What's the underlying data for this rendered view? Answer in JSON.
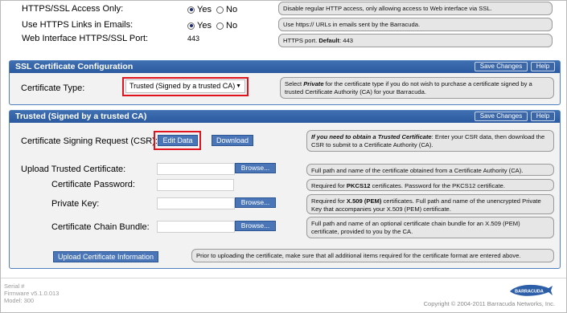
{
  "top": {
    "https_only": {
      "label": "HTTPS/SSL Access Only:",
      "opt_yes": "Yes",
      "opt_no": "No",
      "selected": "Yes",
      "help": "Disable regular HTTP access, only allowing access to Web interface via SSL."
    },
    "https_links": {
      "label": "Use HTTPS Links in Emails:",
      "opt_yes": "Yes",
      "opt_no": "No",
      "selected": "Yes",
      "help": "Use https:// URLs in emails sent by the Barracuda."
    },
    "ssl_port": {
      "label": "Web Interface HTTPS/SSL Port:",
      "value": "443",
      "help_prefix": "HTTPS port. ",
      "help_bold": "Default",
      "help_suffix": ": 443"
    }
  },
  "ssl_panel": {
    "title": "SSL Certificate Configuration",
    "save_label": "Save Changes",
    "help_label": "Help",
    "cert_type_label": "Certificate Type:",
    "cert_type_value": "Trusted (Signed by a trusted CA)",
    "help_pre": "Select ",
    "help_bold": "Private",
    "help_post": " for the certificate type if you do not wish to purchase a certificate signed by a trusted Certificate Authority (CA) for your Barracuda."
  },
  "trusted_panel": {
    "title": "Trusted (Signed by a trusted CA)",
    "save_label": "Save Changes",
    "help_label": "Help",
    "csr_label": "Certificate Signing Request (CSR):",
    "edit_label": "Edit Data",
    "download_label": "Download",
    "csr_help_bold": "If you need to obtain a Trusted Certificate",
    "csr_help_rest": ": Enter your CSR data, then download the CSR to submit to a Certificate Authority (CA).",
    "upload_label": "Upload Trusted Certificate:",
    "upload_help": "Full path and name of the certificate obtained from a Certificate Authority (CA).",
    "password_label": "Certificate Password:",
    "password_help_pre": "Required for ",
    "password_help_bold": "PKCS12",
    "password_help_post": " certificates. Password for the PKCS12 certificate.",
    "key_label": "Private Key:",
    "key_help_pre": "Required for ",
    "key_help_bold": "X.509 (PEM)",
    "key_help_post": " certificates. Full path and name of the unencrypted Private Key that accompanies your X.509 (PEM) certificate.",
    "chain_label": "Certificate Chain Bundle:",
    "chain_help": "Full path and name of an optional certificate chain bundle for an X.509 (PEM) certificate, provided to you by the CA.",
    "browse_label": "Browse...",
    "upload_btn_label": "Upload Certificate Information",
    "upload_btn_help": "Prior to uploading the certificate, make sure that all additional items required for the certificate format are entered above."
  },
  "footer": {
    "serial": "Serial #",
    "firmware": "Firmware v5.1.0.013",
    "model": "Model: 300",
    "copyright": "Copyright © 2004-2011 Barracuda Networks, Inc.",
    "logo_text": "BARRACUDA"
  },
  "colors": {
    "panel_header": "#2b5aa0",
    "highlight_box": "#e0141e",
    "button": "#4a76b8"
  }
}
